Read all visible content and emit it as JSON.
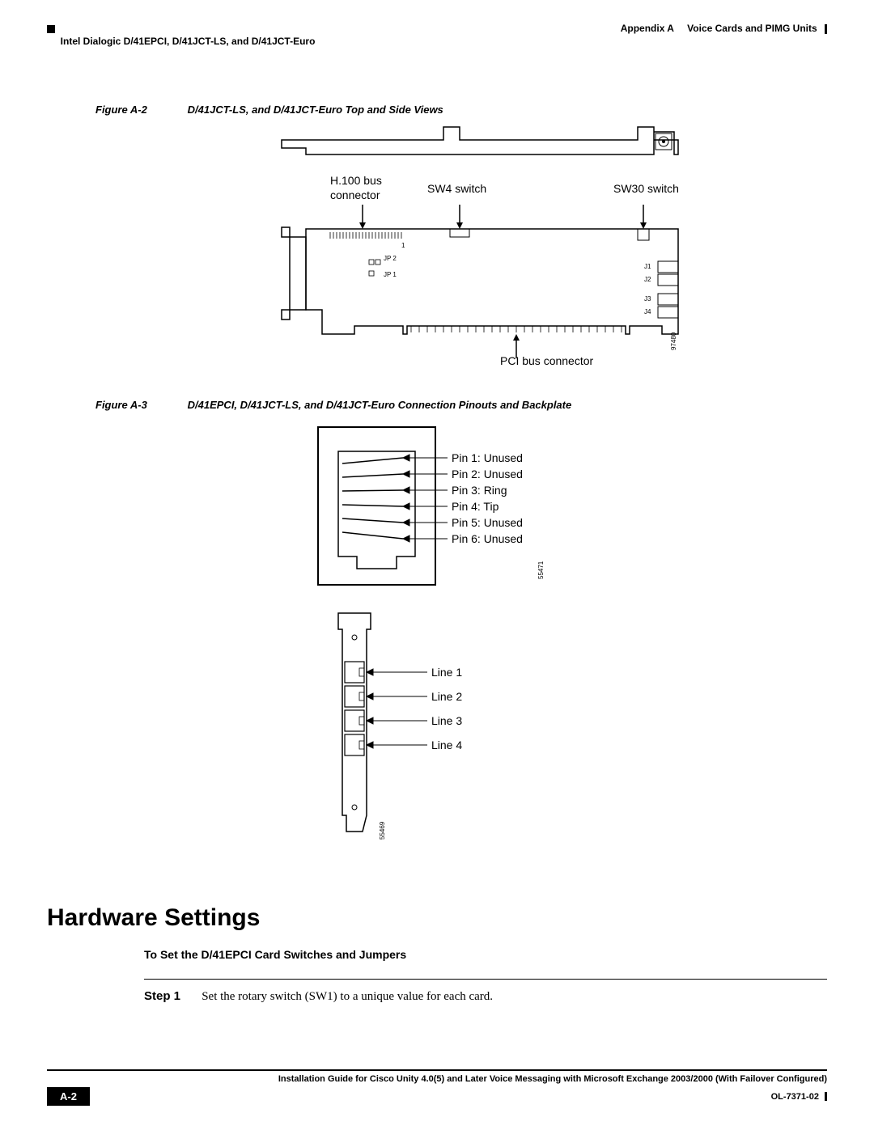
{
  "header": {
    "appendix": "Appendix A",
    "appendix_title": "Voice Cards and PIMG Units",
    "section": "Intel Dialogic D/41EPCI, D/41JCT-LS, and D/41JCT-Euro"
  },
  "figure_a2": {
    "label": "Figure A-2",
    "caption": "D/41JCT-LS, and D/41JCT-Euro Top and Side Views",
    "labels": {
      "h100_bus": "H.100 bus",
      "connector": "connector",
      "sw4": "SW4 switch",
      "sw30": "SW30 switch",
      "pci_bus": "PCI bus connector",
      "jp2": "JP 2",
      "jp1": "JP 1",
      "one": "1",
      "j1": "J1",
      "j2": "J2",
      "j3": "J3",
      "j4": "J4",
      "num": "97480"
    }
  },
  "figure_a3": {
    "label": "Figure A-3",
    "caption": "D/41EPCI, D/41JCT-LS, and D/41JCT-Euro Connection Pinouts and Backplate",
    "pins": {
      "p1": "Pin 1: Unused",
      "p2": "Pin 2: Unused",
      "p3": "Pin 3: Ring",
      "p4": "Pin 4: Tip",
      "p5": "Pin 5: Unused",
      "p6": "Pin 6: Unused",
      "num": "55471"
    },
    "backplate": {
      "l1": "Line 1",
      "l2": "Line 2",
      "l3": "Line 3",
      "l4": "Line 4",
      "num": "55469"
    }
  },
  "section_heading": "Hardware Settings",
  "subsection": "To Set the D/41EPCI Card Switches and Jumpers",
  "step": {
    "label": "Step 1",
    "text": "Set the rotary switch (SW1) to a unique value for each card."
  },
  "footer": {
    "title": "Installation Guide for Cisco Unity 4.0(5) and Later Voice Messaging with Microsoft Exchange 2003/2000 (With Failover Configured)",
    "page": "A-2",
    "doc": "OL-7371-02"
  }
}
